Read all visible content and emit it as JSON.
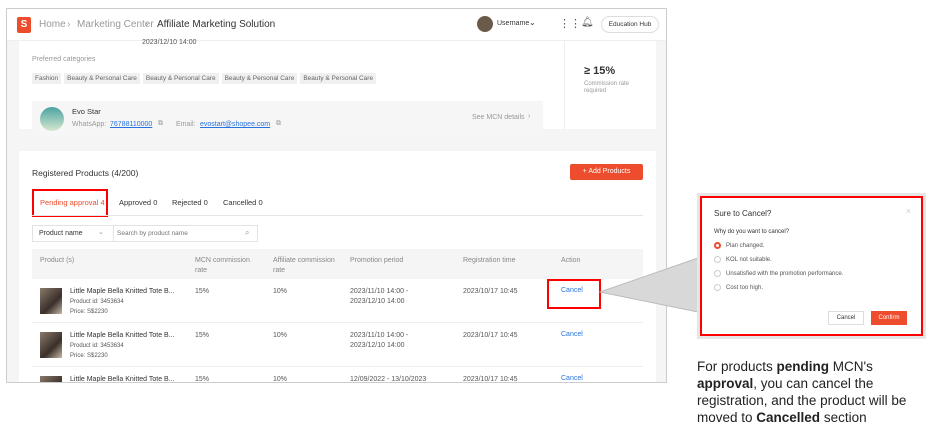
{
  "header": {
    "breadcrumb": [
      "Home",
      "Marketing Center",
      "Affiliate Marketing Solution"
    ],
    "username": "Username",
    "education_hub": "Education Hub"
  },
  "top_card": {
    "date": "2023/12/10 14:00",
    "preferred_label": "Preferred categories",
    "categories": [
      "Fashion",
      "Beauty & Personal Care",
      "Beauty & Personal Care",
      "Beauty & Personal Care",
      "Beauty & Personal Care"
    ],
    "commission_value": "≥ 15%",
    "commission_label": "Commission rate required",
    "mcn": {
      "name": "Evo Star",
      "whatsapp_label": "WhatsApp:",
      "whatsapp": "76788110000",
      "email_label": "Email:",
      "email": "evostart@shopee.com",
      "details": "See MCN details"
    }
  },
  "products": {
    "title": "Registered Products (4/200)",
    "add_button": "Add Products",
    "tabs": [
      "Pending approval 4",
      "Approved 0",
      "Rejected 0",
      "Cancelled 0"
    ],
    "filter_select": "Product name",
    "search_placeholder": "Search by product name",
    "columns": [
      "Product (s)",
      "MCN commission rate",
      "Affiliate commission rate",
      "Promotion period",
      "Registration time",
      "Action"
    ],
    "rows": [
      {
        "name": "Little Maple Bella Knitted Tote B...",
        "id": "Product id: 3453634",
        "price": "Price: S$2230",
        "mcn": "15%",
        "aff": "10%",
        "period1": "2023/11/10 14:00 -",
        "period2": "2023/12/10 14:00",
        "reg": "2023/10/17 10:45",
        "action": "Cancel"
      },
      {
        "name": "Little Maple Bella Knitted Tote B...",
        "id": "Product id: 3453634",
        "price": "Price: S$2230",
        "mcn": "15%",
        "aff": "10%",
        "period1": "2023/11/10 14:00 -",
        "period2": "2023/12/10 14:00",
        "reg": "2023/10/17 10:45",
        "action": "Cancel"
      },
      {
        "name": "Little Maple Bella Knitted Tote B...",
        "id": "",
        "price": "",
        "mcn": "15%",
        "aff": "10%",
        "period1": "12/09/2022 - 13/10/2023",
        "period2": "",
        "reg": "2023/10/17 10:45",
        "action": "Cancel"
      }
    ]
  },
  "dialog": {
    "title": "Sure to Cancel?",
    "question": "Why do you want to cancel?",
    "options": [
      "Plan changed.",
      "KOL not suitable.",
      "Unsatisfied with the promotion performance.",
      "Cost too high."
    ],
    "selected": 0,
    "cancel": "Cancel",
    "confirm": "Confirm"
  },
  "caption": {
    "p1": "For products ",
    "b1": "pending",
    "p2": " MCN's ",
    "b2": "approval",
    "p3": ", you can cancel the registration, and the product will be moved to ",
    "b3": "Cancelled",
    "p4": " section"
  },
  "colors": {
    "brand": "#ee4d2d",
    "link": "#2673dd",
    "highlight": "#ff0000"
  }
}
